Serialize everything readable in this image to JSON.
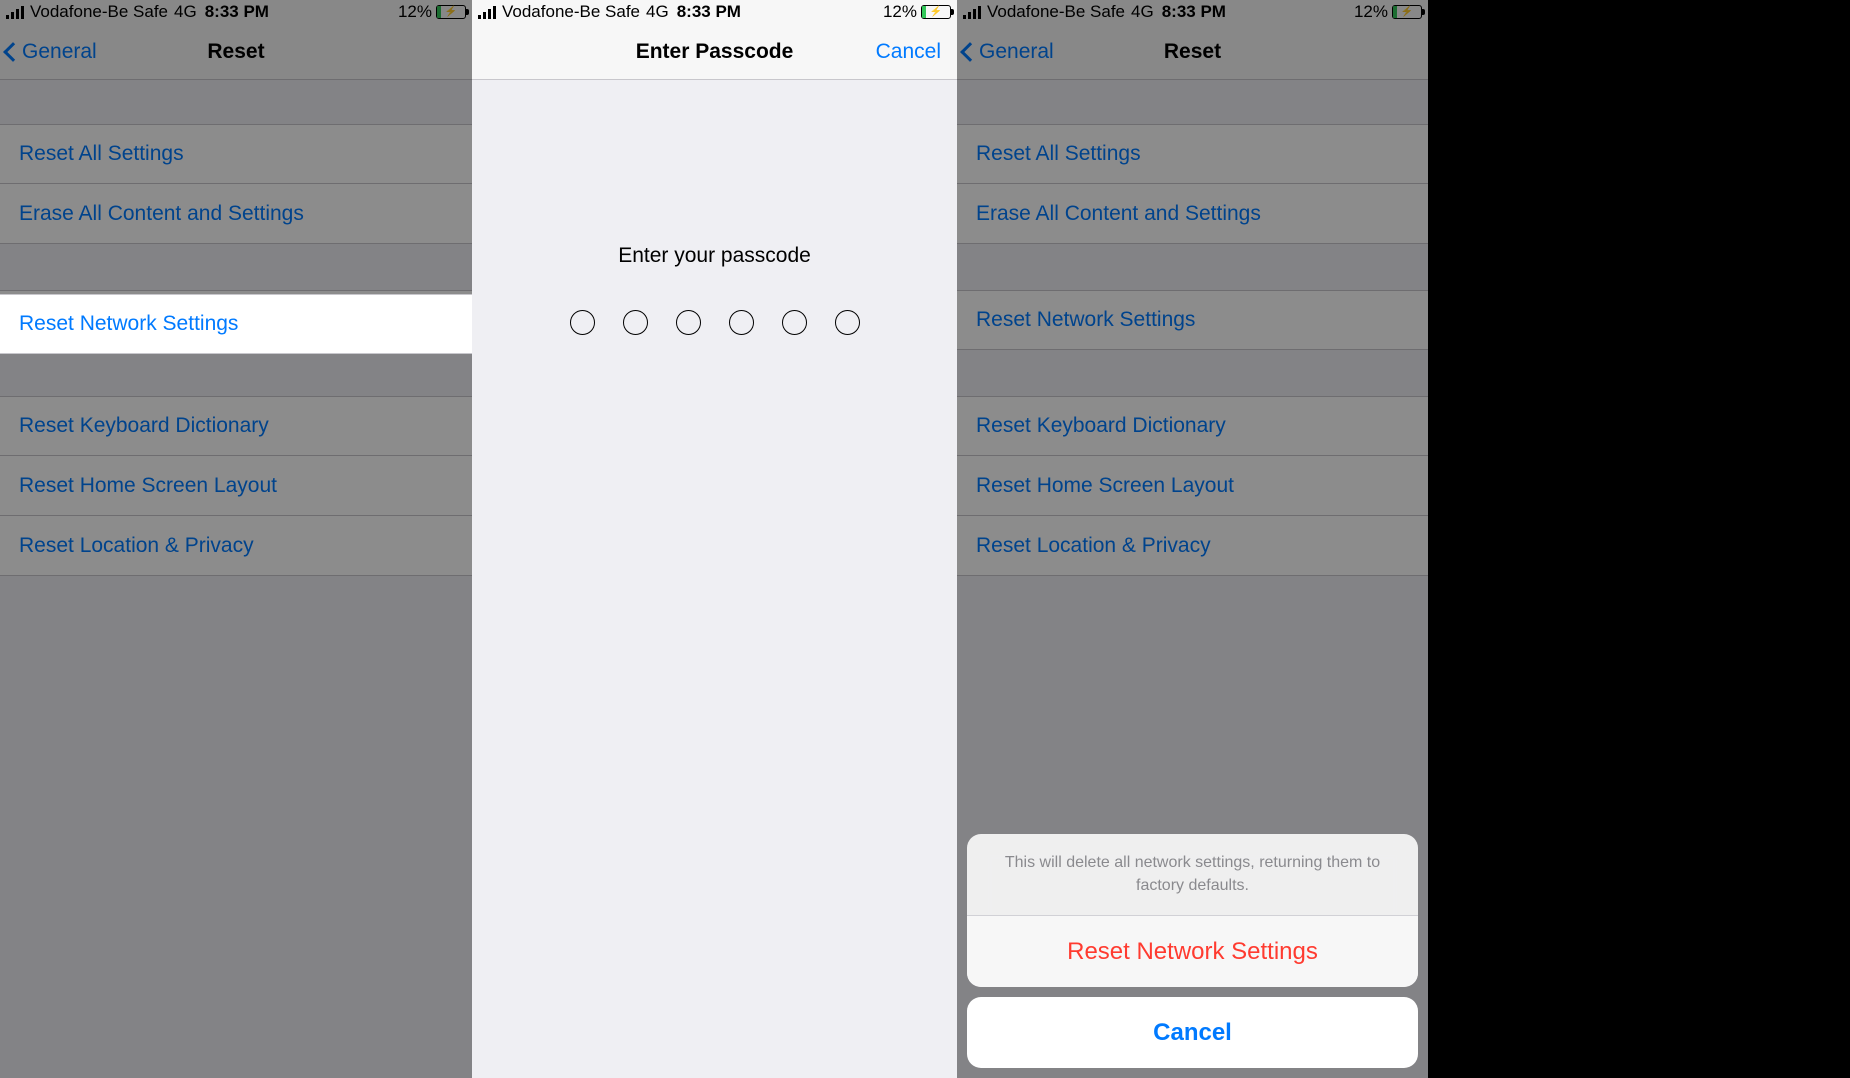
{
  "status": {
    "carrier": "Vodafone-Be Safe",
    "network": "4G",
    "time": "8:33 PM",
    "battery_pct": "12%"
  },
  "screen1": {
    "back_label": "General",
    "title": "Reset",
    "items": {
      "reset_all": "Reset All Settings",
      "erase_all": "Erase All Content and Settings",
      "reset_network": "Reset Network Settings",
      "reset_keyboard": "Reset Keyboard Dictionary",
      "reset_home": "Reset Home Screen Layout",
      "reset_location": "Reset Location & Privacy"
    }
  },
  "screen2": {
    "title": "Enter Passcode",
    "cancel_label": "Cancel",
    "prompt": "Enter your passcode"
  },
  "screen3": {
    "back_label": "General",
    "title": "Reset",
    "items": {
      "reset_all": "Reset All Settings",
      "erase_all": "Erase All Content and Settings",
      "reset_network": "Reset Network Settings",
      "reset_keyboard": "Reset Keyboard Dictionary",
      "reset_home": "Reset Home Screen Layout",
      "reset_location": "Reset Location & Privacy"
    },
    "sheet": {
      "message": "This will delete all network settings, returning them to factory defaults.",
      "destructive": "Reset Network Settings",
      "cancel": "Cancel"
    }
  }
}
